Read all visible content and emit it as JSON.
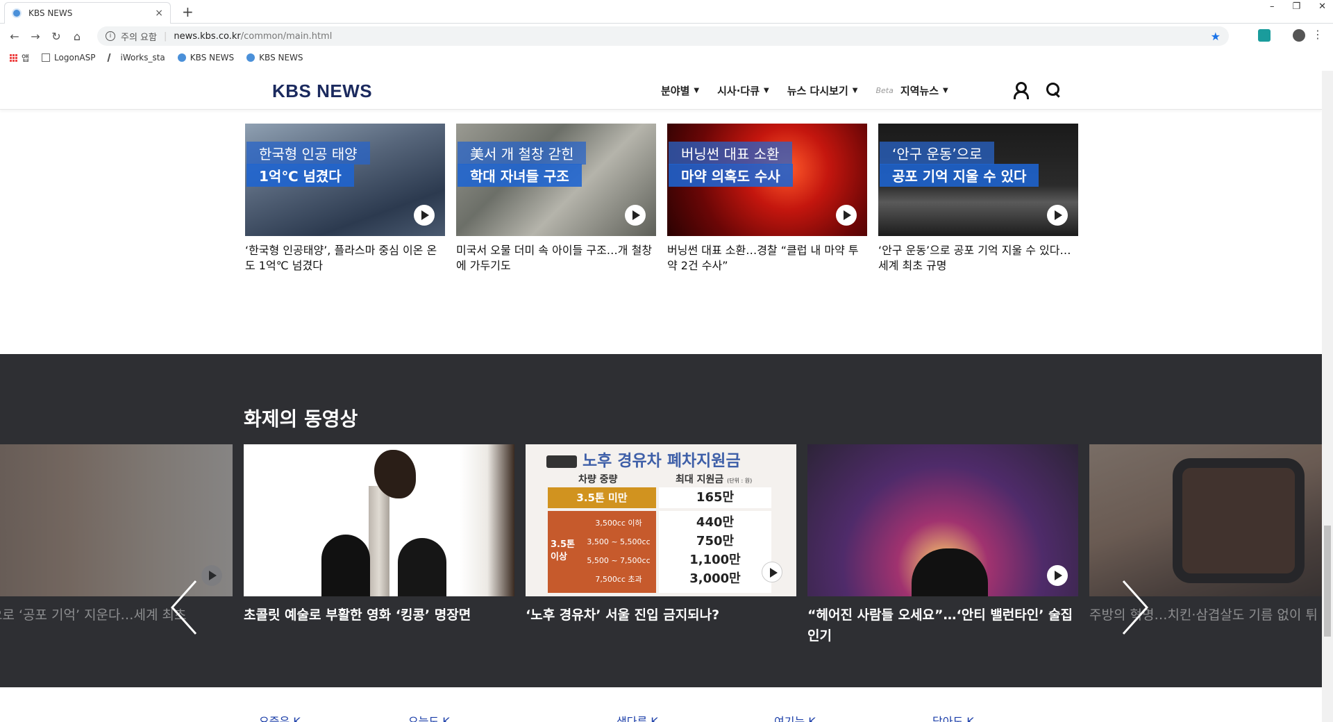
{
  "browser": {
    "tab_title": "KBS NEWS",
    "new_tab_symbol": "+",
    "tab_close": "×",
    "window_controls": [
      "–",
      "❐",
      "✕"
    ],
    "nav": {
      "back": "←",
      "forward": "→",
      "reload": "↻",
      "home": "⌂"
    },
    "address": {
      "warning": "주의 요함",
      "host": "news.kbs.co.kr",
      "path": "/common/main.html"
    },
    "bookmarks": [
      {
        "label": "앱"
      },
      {
        "label": "LogonASP"
      },
      {
        "label": "iWorks_sta"
      },
      {
        "label": "KBS NEWS"
      },
      {
        "label": "KBS NEWS"
      }
    ],
    "menu_symbol": "⋮",
    "star_symbol": "★"
  },
  "site": {
    "logo": "KBS NEWS",
    "menu": [
      {
        "label": "분야별",
        "caret": "▼"
      },
      {
        "label": "시사·다큐",
        "caret": "▼"
      },
      {
        "label": "뉴스 다시보기",
        "caret": "▼"
      },
      {
        "beta": "Beta",
        "label": "지역뉴스",
        "caret": "▼"
      }
    ]
  },
  "news_cards": [
    {
      "cap1": "한국형 인공 태양",
      "cap2": "1억℃ 넘겼다",
      "headline": "‘한국형 인공태양’, 플라스마 중심 이온 온도 1억℃ 넘겼다"
    },
    {
      "cap1": "美서 개 철창 갇힌",
      "cap2": "학대 자녀들 구조",
      "headline": "미국서 오물 더미 속 아이들 구조…개 철창에 가두기도"
    },
    {
      "cap1": "버닝썬 대표 소환",
      "cap2": "마약 의혹도 수사",
      "headline": "버닝썬 대표 소환…경찰 “클럽 내 마약 투약 2건 수사”"
    },
    {
      "cap1": "‘안구 운동’으로",
      "cap2": "공포 기억 지울 수 있다",
      "headline": "‘안구 운동’으로 공포 기억 지울 수 있다…세계 최초 규명"
    }
  ],
  "video_section": {
    "title": "화제의 동영상",
    "items": [
      {
        "title": "운동’으로 ‘공포 기억’ 지운다…세계 최초"
      },
      {
        "title": "초콜릿 예술로 부활한 영화 ‘킹콩’ 명장면"
      },
      {
        "title": "‘노후 경유차’ 서울 진입 금지되나?"
      },
      {
        "title": "“헤어진 사람들 오세요”…‘안티 밸런타인’ 술집 인기"
      },
      {
        "title": "주방의 혁명…치킨·삼겹살도 기름 없이 튀"
      }
    ],
    "subsidy": {
      "heading": "노후 경유차 폐차지원금",
      "col1": "차량 중량",
      "col2": "최대 지원금",
      "unit": "(단위 : 원)",
      "row_light_label": "3.5톤 미만",
      "row_light_value": "165만",
      "heavy_label": "3.5톤 이상",
      "rows": [
        {
          "cc": "3,500cc 이하",
          "amt": "440만"
        },
        {
          "cc": "3,500 ~ 5,500cc",
          "amt": "750만"
        },
        {
          "cc": "5,500 ~ 7,500cc",
          "amt": "1,100만"
        },
        {
          "cc": "7,500cc 초과",
          "amt": "3,000만"
        }
      ]
    }
  },
  "footer_nav": [
    "요즘은 K",
    "오늘도 K",
    "생다른 K",
    "여기는 K",
    "닮아도 K"
  ]
}
